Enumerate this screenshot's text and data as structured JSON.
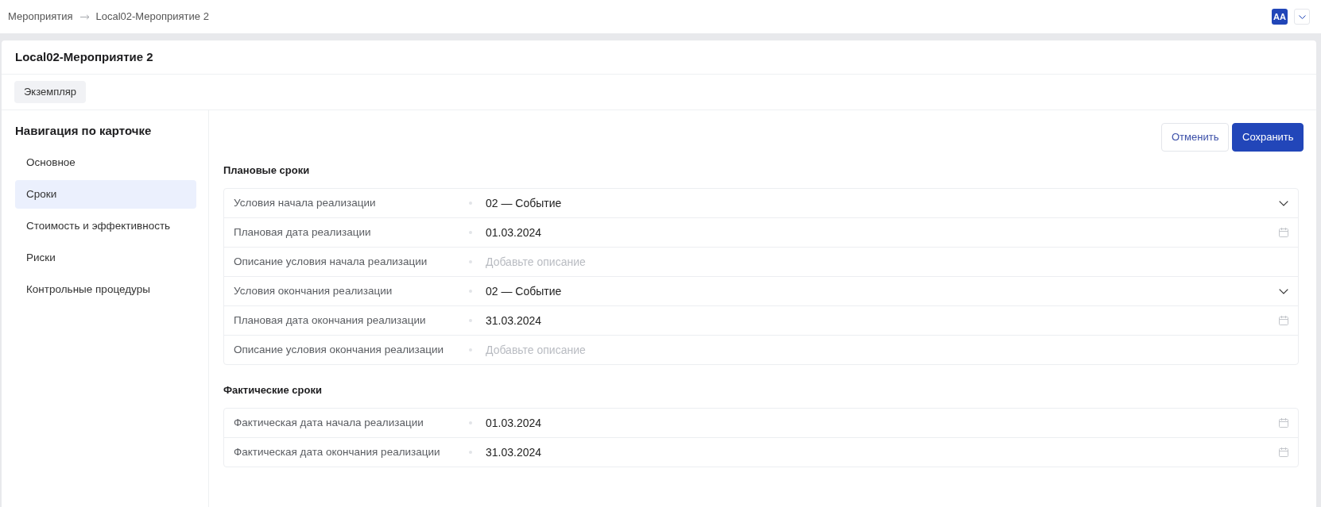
{
  "breadcrumb": [
    {
      "label": "Мероприятия"
    },
    {
      "label": "Local02-Мероприятие 2"
    }
  ],
  "user": {
    "initials": "AA"
  },
  "card": {
    "title": "Local02-Мероприятие 2",
    "tabs": [
      {
        "label": "Экземпляр",
        "selected": true
      }
    ]
  },
  "navigation": {
    "title": "Навигация по карточке",
    "items": [
      {
        "label": "Основное",
        "selected": false
      },
      {
        "label": "Сроки",
        "selected": true
      },
      {
        "label": "Стоимость и эффективность",
        "selected": false
      },
      {
        "label": "Риски",
        "selected": false
      },
      {
        "label": "Контрольные процедуры",
        "selected": false
      }
    ]
  },
  "actions": [
    {
      "label": "Отменить",
      "kind": "secondary"
    },
    {
      "label": "Сохранить",
      "kind": "primary"
    }
  ],
  "sections": [
    {
      "title": "Плановые сроки",
      "fields": [
        {
          "label": "Условия начала реализации",
          "kind": "select",
          "value": "02 — Событие"
        },
        {
          "label": "Плановая дата реализации",
          "kind": "date",
          "value": "01.03.2024"
        },
        {
          "label": "Описание условия начала реализации",
          "kind": "text",
          "placeholder": "Добавьте описание"
        },
        {
          "label": "Условия окончания реализации",
          "kind": "select",
          "value": "02 — Событие"
        },
        {
          "label": "Плановая дата окончания реализации",
          "kind": "date",
          "value": "31.03.2024"
        },
        {
          "label": "Описание условия окончания реализации",
          "kind": "text",
          "placeholder": "Добавьте описание"
        }
      ]
    },
    {
      "title": "Фактические сроки",
      "fields": [
        {
          "label": "Фактическая дата начала реализации",
          "kind": "date",
          "value": "01.03.2024"
        },
        {
          "label": "Фактическая дата окончания реализации",
          "kind": "date",
          "value": "31.03.2024"
        }
      ]
    }
  ]
}
